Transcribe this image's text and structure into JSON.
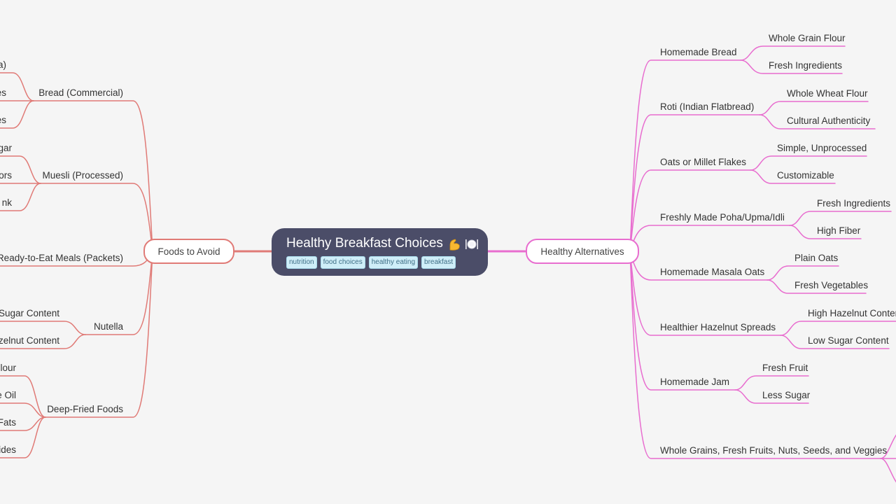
{
  "mindmap": {
    "central": {
      "title": "Healthy Breakfast Choices",
      "emoji": [
        "flexed-biceps",
        "fork-knife-plate"
      ],
      "tags": [
        "nutrition",
        "food choices",
        "healthy eating",
        "breakfast"
      ],
      "bg_color": "#4b4d68",
      "tag_bg": "#cfeef8"
    },
    "left_branch": {
      "label": "Foods to Avoid",
      "color": "#e07a76",
      "children": [
        {
          "label": "Bread (Commercial)",
          "children": [
            "a)",
            "es",
            "es"
          ]
        },
        {
          "label": "Muesli (Processed)",
          "children": [
            "gar",
            "ors",
            "nk"
          ]
        },
        {
          "label": "Ready-to-Eat Meals (Packets)",
          "children": []
        },
        {
          "label": "Nutella",
          "children": [
            "Sugar Content",
            "zelnut Content"
          ]
        },
        {
          "label": "Deep-Fried Foods",
          "children": [
            "lour",
            "e Oil",
            "Fats",
            "ides"
          ]
        }
      ]
    },
    "right_branch": {
      "label": "Healthy Alternatives",
      "color": "#e86dcf",
      "children": [
        {
          "label": "Homemade Bread",
          "children": [
            "Whole Grain Flour",
            "Fresh Ingredients"
          ]
        },
        {
          "label": "Roti (Indian Flatbread)",
          "children": [
            "Whole Wheat Flour",
            "Cultural Authenticity"
          ]
        },
        {
          "label": "Oats or Millet Flakes",
          "children": [
            "Simple, Unprocessed",
            "Customizable"
          ]
        },
        {
          "label": "Freshly Made Poha/Upma/Idli",
          "children": [
            "Fresh Ingredients",
            "High Fiber"
          ]
        },
        {
          "label": "Homemade Masala Oats",
          "children": [
            "Plain Oats",
            "Fresh Vegetables"
          ]
        },
        {
          "label": "Healthier Hazelnut Spreads",
          "children": [
            "High Hazelnut Content",
            "Low Sugar Content"
          ]
        },
        {
          "label": "Homemade Jam",
          "children": [
            "Fresh Fruit",
            "Less Sugar"
          ]
        },
        {
          "label": "Whole Grains, Fresh Fruits, Nuts, Seeds, and Veggies",
          "children": []
        }
      ]
    }
  }
}
